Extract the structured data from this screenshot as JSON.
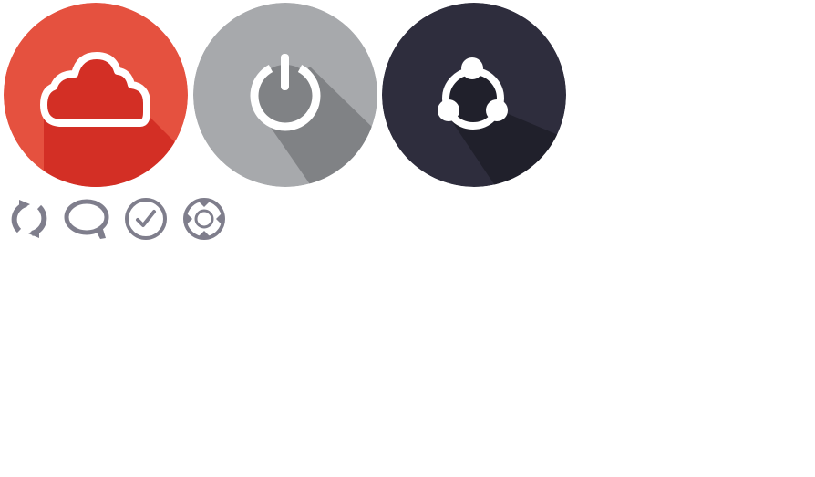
{
  "icons": {
    "large": [
      {
        "name": "cloud-icon",
        "background": "#e5513f",
        "shadow": "#d32f25",
        "glyph": "#ffffff"
      },
      {
        "name": "power-icon",
        "background": "#a7a9ac",
        "shadow": "#808285",
        "glyph": "#ffffff"
      },
      {
        "name": "share-icon",
        "background": "#2e2d3d",
        "shadow": "#20202b",
        "glyph": "#ffffff"
      }
    ],
    "small": [
      {
        "name": "refresh-icon",
        "color": "#7f7e8c"
      },
      {
        "name": "chat-bubble-icon",
        "color": "#7f7e8c"
      },
      {
        "name": "check-circle-icon",
        "color": "#7f7e8c"
      },
      {
        "name": "crosshair-icon",
        "color": "#7f7e8c"
      }
    ]
  }
}
